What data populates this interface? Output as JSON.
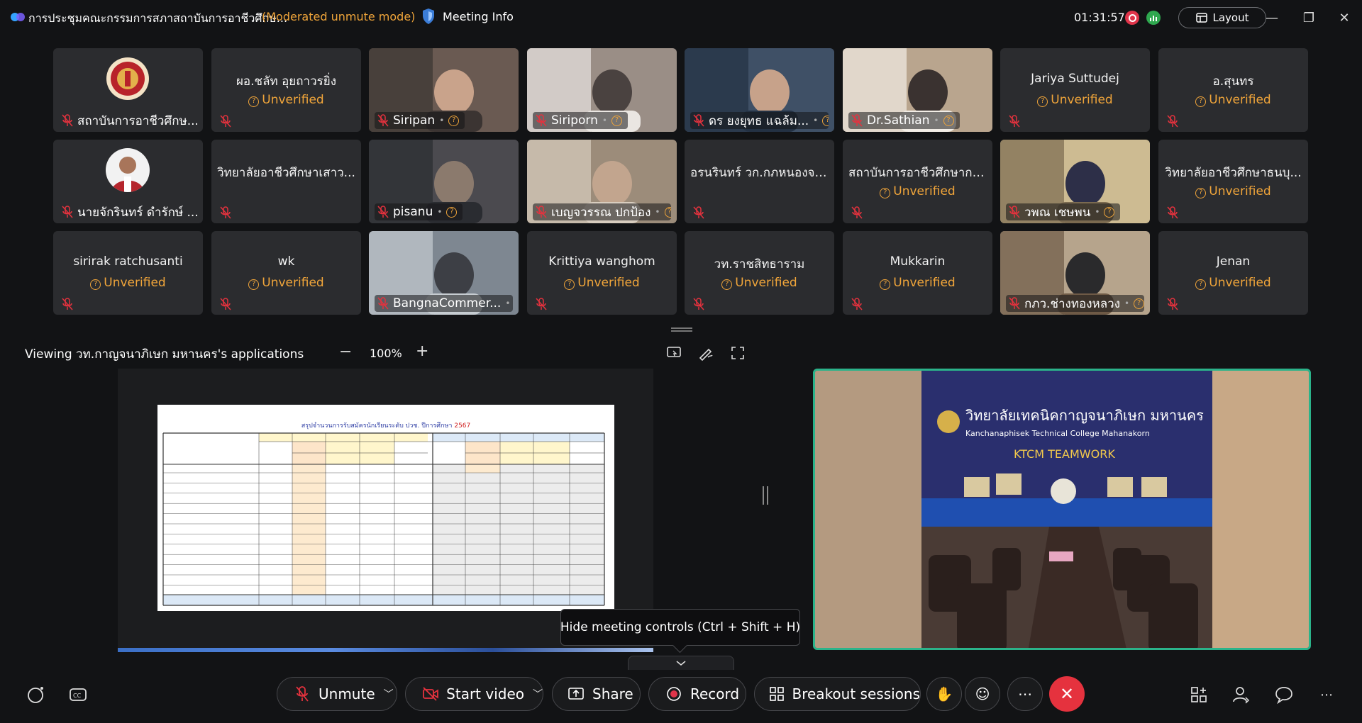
{
  "titlebar": {
    "meeting_title": "การประชุมคณะกรรมการสภาสถาบันการอาชีวศึกษ...",
    "mode_label": "(Moderated unmute mode)",
    "meeting_info_label": "Meeting Info",
    "timer": "01:31:57",
    "layout_label": "Layout"
  },
  "participants": [
    {
      "name": "สถาบันการอาชีวศึกษ...",
      "status": "",
      "type": "logo"
    },
    {
      "name": "ผอ.ชลัท อุยถาวรยิ่ง",
      "status": "Unverified",
      "type": "text"
    },
    {
      "name": "Siripan",
      "status": "",
      "type": "video"
    },
    {
      "name": "Siriporn",
      "status": "",
      "type": "video"
    },
    {
      "name": "ดร ยงยุทธ แฉล้ม...",
      "status": "",
      "type": "video"
    },
    {
      "name": "Dr.Sathian",
      "status": "",
      "type": "video"
    },
    {
      "name": "Jariya Suttudej",
      "status": "Unverified",
      "type": "text"
    },
    {
      "name": "อ.สุนทร",
      "status": "Unverified",
      "type": "text"
    },
    {
      "name": "นายจักรินทร์ ดำรักษ์ ...",
      "status": "",
      "type": "avatar"
    },
    {
      "name": "วิทยาลัยอาชีวศึกษาเสาว...",
      "status": "",
      "type": "text"
    },
    {
      "name": "pisanu",
      "status": "",
      "type": "video"
    },
    {
      "name": "เบญจวรรณ ปกป้อง",
      "status": "",
      "type": "video"
    },
    {
      "name": "อรนรินทร์ วก.กภหนองจอก",
      "status": "",
      "type": "text"
    },
    {
      "name": "สถาบันการอาชีวศึกษากรุ...",
      "status": "Unverified",
      "type": "text"
    },
    {
      "name": "วพณ เชษพน",
      "status": "",
      "type": "video"
    },
    {
      "name": "วิทยาลัยอาชีวศึกษาธนบุ...",
      "status": "Unverified",
      "type": "text"
    },
    {
      "name": "sirirak ratchusanti",
      "status": "Unverified",
      "type": "text"
    },
    {
      "name": "wk",
      "status": "Unverified",
      "type": "text"
    },
    {
      "name": "BangnaCommer...",
      "status": "",
      "type": "video"
    },
    {
      "name": "Krittiya wanghom",
      "status": "Unverified",
      "type": "text"
    },
    {
      "name": "วท.ราชสิทธาราม",
      "status": "Unverified",
      "type": "text"
    },
    {
      "name": "Mukkarin",
      "status": "Unverified",
      "type": "text"
    },
    {
      "name": "กภว.ช่างทองหลวง",
      "status": "",
      "type": "video"
    },
    {
      "name": "Jenan",
      "status": "Unverified",
      "type": "text"
    }
  ],
  "share": {
    "viewing_label": "Viewing วท.กาญจนาภิเษก มหานคร's applications",
    "zoom": "100%",
    "sheet_title_prefix": "สรุปจำนวนการรับสมัครนักเรียนระดับ ปวช. ปีการศึกษา",
    "sheet_title_year": "2567"
  },
  "speaker": {
    "banner_thai": "วิทยาลัยเทคนิคกาญจนาภิเษก มหานคร",
    "banner_en": "Kanchanaphisek Technical College Mahanakorn",
    "banner_team": "KTCM TEAMWORK"
  },
  "tooltip": "Hide meeting controls  (Ctrl + Shift + H)",
  "controls": {
    "unmute": "Unmute",
    "start_video": "Start video",
    "share": "Share",
    "record": "Record",
    "breakout": "Breakout sessions"
  },
  "colors": {
    "unverified": "#f0a53a",
    "accent_green": "#2bb38a",
    "leave_red": "#e5323e",
    "record_red": "#e0344a"
  }
}
